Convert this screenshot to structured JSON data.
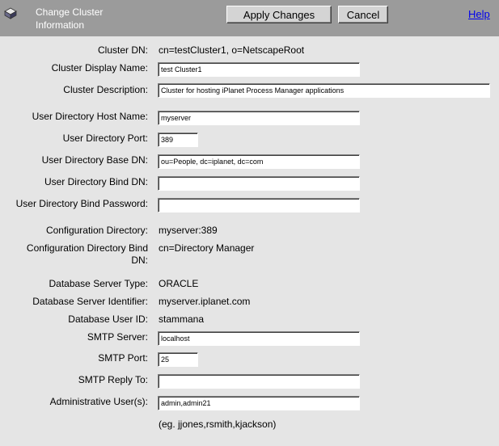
{
  "header": {
    "title": "Change Cluster Information",
    "apply_label": "Apply Changes",
    "cancel_label": "Cancel",
    "help_label": "Help",
    "bg_color": "#9b9b9b"
  },
  "form": {
    "cluster_dn": {
      "label": "Cluster DN:",
      "value": "cn=testCluster1, o=NetscapeRoot"
    },
    "cluster_display_name": {
      "label": "Cluster Display Name:",
      "value": "test Cluster1"
    },
    "cluster_description": {
      "label": "Cluster Description:",
      "value": "Cluster for hosting iPlanet Process Manager applications"
    },
    "user_dir_host": {
      "label": "User Directory Host Name:",
      "value": "myserver"
    },
    "user_dir_port": {
      "label": "User Directory Port:",
      "value": "389"
    },
    "user_dir_base_dn": {
      "label": "User Directory Base DN:",
      "value": "ou=People, dc=iplanet, dc=com"
    },
    "user_dir_bind_dn": {
      "label": "User Directory Bind DN:",
      "value": ""
    },
    "user_dir_bind_password": {
      "label": "User Directory Bind Password:",
      "value": ""
    },
    "config_directory": {
      "label": "Configuration Directory:",
      "value": "myserver:389"
    },
    "config_directory_bind_dn": {
      "label": "Configuration Directory Bind DN:",
      "value": "cn=Directory Manager"
    },
    "db_server_type": {
      "label": "Database Server Type:",
      "value": "ORACLE"
    },
    "db_server_identifier": {
      "label": "Database Server Identifier:",
      "value": "myserver.iplanet.com"
    },
    "db_user_id": {
      "label": "Database User ID:",
      "value": "stammana"
    },
    "smtp_server": {
      "label": "SMTP Server:",
      "value": "localhost"
    },
    "smtp_port": {
      "label": "SMTP Port:",
      "value": "25"
    },
    "smtp_reply_to": {
      "label": "SMTP Reply To:",
      "value": ""
    },
    "admin_users": {
      "label": "Administrative User(s):",
      "value": "admin,admin21",
      "hint": "(eg. jjones,rsmith,kjackson)"
    }
  }
}
